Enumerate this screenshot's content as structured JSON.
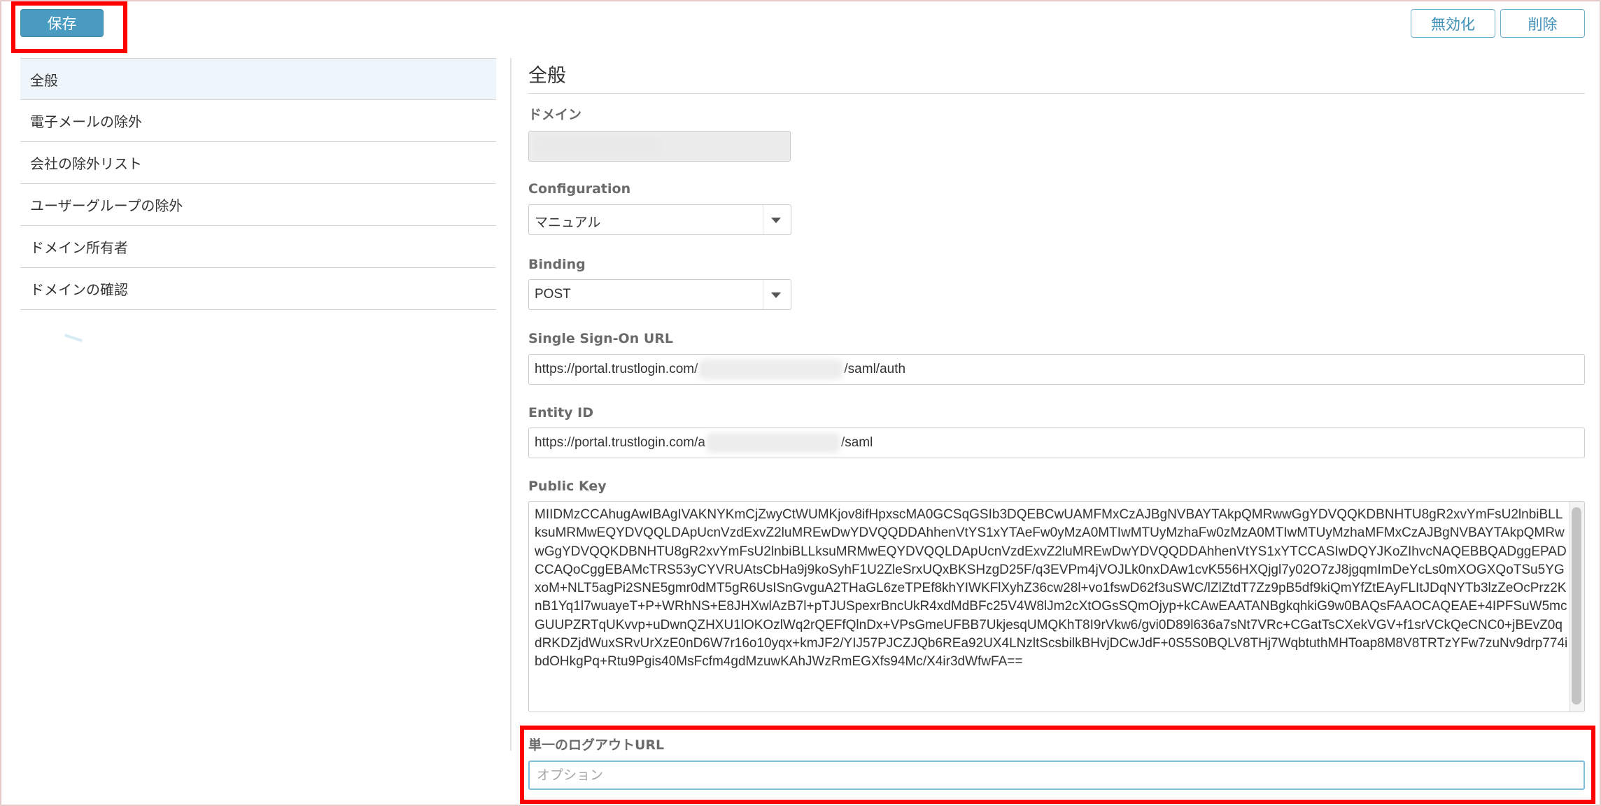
{
  "toolbar": {
    "save_label": "保存",
    "disable_label": "無効化",
    "delete_label": "削除"
  },
  "sidebar": {
    "items": [
      {
        "label": "全般",
        "active": true
      },
      {
        "label": "電子メールの除外"
      },
      {
        "label": "会社の除外リスト"
      },
      {
        "label": "ユーザーグループの除外"
      },
      {
        "label": "ドメイン所有者"
      },
      {
        "label": "ドメインの確認"
      }
    ]
  },
  "main": {
    "title": "全般",
    "domain": {
      "label": "ドメイン",
      "value": ""
    },
    "configuration": {
      "label": "Configuration",
      "value": "マニュアル"
    },
    "binding": {
      "label": "Binding",
      "value": "POST"
    },
    "sso_url": {
      "label": "Single Sign-On URL",
      "prefix": "https://portal.trustlogin.com/",
      "suffix": "/saml/auth"
    },
    "entity_id": {
      "label": "Entity ID",
      "prefix": "https://portal.trustlogin.com/a",
      "suffix": "/saml"
    },
    "public_key": {
      "label": "Public Key",
      "value": "MIIDMzCCAhugAwIBAgIVAKNYKmCjZwyCtWUMKjov8ifHpxscMA0GCSqGSIb3DQEBCwUAMFMxCzAJBgNVBAYTAkpQMRwwGgYDVQQKDBNHTU8gR2xvYmFsU2lnbiBLLksuMRMwEQYDVQQLDApUcnVzdExvZ2luMREwDwYDVQQDDAhhenVtYS1xYTAeFw0yMzA0MTIwMTUyMzhaFw0zMzA0MTIwMTUyMzhaMFMxCzAJBgNVBAYTAkpQMRwwGgYDVQQKDBNHTU8gR2xvYmFsU2lnbiBLLksuMRMwEQYDVQQLDApUcnVzdExvZ2luMREwDwYDVQQDDAhhenVtYS1xYTCCASIwDQYJKoZIhvcNAQEBBQADggEPADCCAQoCggEBAMcTRS53yCYVRUAtsCbHa9j9koSyhF1U2ZleSrxUQxBKSHzgD25F/q3EVPm4jVOJLk0nxDAw1cvK556HXQjgl7y02O7zJ8jgqmImDeYcLs0mXOGXQoTSu5YGxoM+NLT5agPi2SNE5gmr0dMT5gR6UsISnGvguA2THaGL6zeTPEf8khYIWKFlXyhZ36cw28l+vo1fswD62f3uSWC/lZlZtdT7Zz9pB5df9kiQmYfZtEAyFLItJDqNYTb3lzZeOcPrz2KnB1Yq1l7wuayeT+P+WRhNS+E8JHXwlAzB7l+pTJUSpexrBncUkR4xdMdBFc25V4W8lJm2cXtOGsSQmOjyp+kCAwEAATANBgkqhkiG9w0BAQsFAAOCAQEAE+4IPFSuW5mcGUUPZRTqUKvvp+uDwnQZHXU1lOKOzlWq2rQEFfQlnDx+VPsGmeUFBB7UkjesqUMQKhT8I9rVkw6/gvi0D89l636a7sNt7VRc+CGatTsCXekVGV+f1srVCkQeCNC0+jBEvZ0qdRKDZjdWuxSRvUrXzE0nD6W7r16o10yqx+kmJF2/YIJ57PJCZJQb6REa92UX4LNzltScsbilkBHvjDCwJdF+0S5S0BQLV8THj7WqbtuthMHToap8M8V8TRTzYFw7zuNv9drp774ibdOHkgPq+Rtu9Pgis40MsFcfm4gdMzuwKAhJWzRmEGXfs94Mc/X4ir3dWfwFA=="
    },
    "slo_url": {
      "label": "単一のログアウトURL",
      "placeholder": "オプション"
    }
  }
}
